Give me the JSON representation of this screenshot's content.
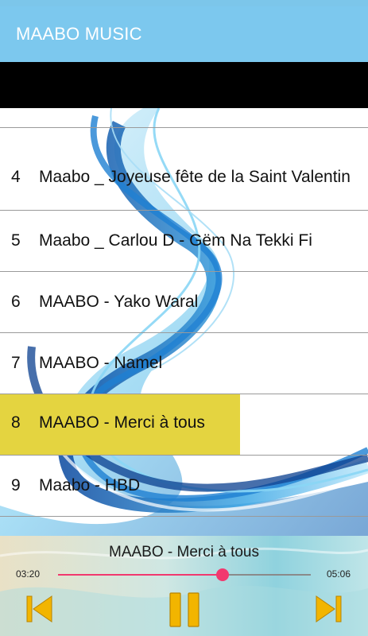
{
  "app": {
    "title": "MAABO MUSIC"
  },
  "colors": {
    "app_bar": "#7cc8ee",
    "selected_row": "#e4d440",
    "seek_accent": "#f1386e",
    "control_gold": "#f2b500"
  },
  "tracks": [
    {
      "number": "4",
      "title": "Maabo _ Joyeuse fête de la Saint Valentin"
    },
    {
      "number": "5",
      "title": "Maabo _ Carlou D - Gëm Na Tekki Fi"
    },
    {
      "number": "6",
      "title": "MAABO - Yako Waral"
    },
    {
      "number": "7",
      "title": "MAABO - Namel"
    },
    {
      "number": "8",
      "title": "MAABO - Merci à tous"
    },
    {
      "number": "9",
      "title": "Maabo - HBD"
    }
  ],
  "player": {
    "now_playing": "MAABO - Merci à tous",
    "current_time": "03:20",
    "total_time": "05:06",
    "progress": 0.65,
    "prev_icon": "skip-previous-icon",
    "pause_icon": "pause-icon",
    "next_icon": "skip-next-icon"
  }
}
